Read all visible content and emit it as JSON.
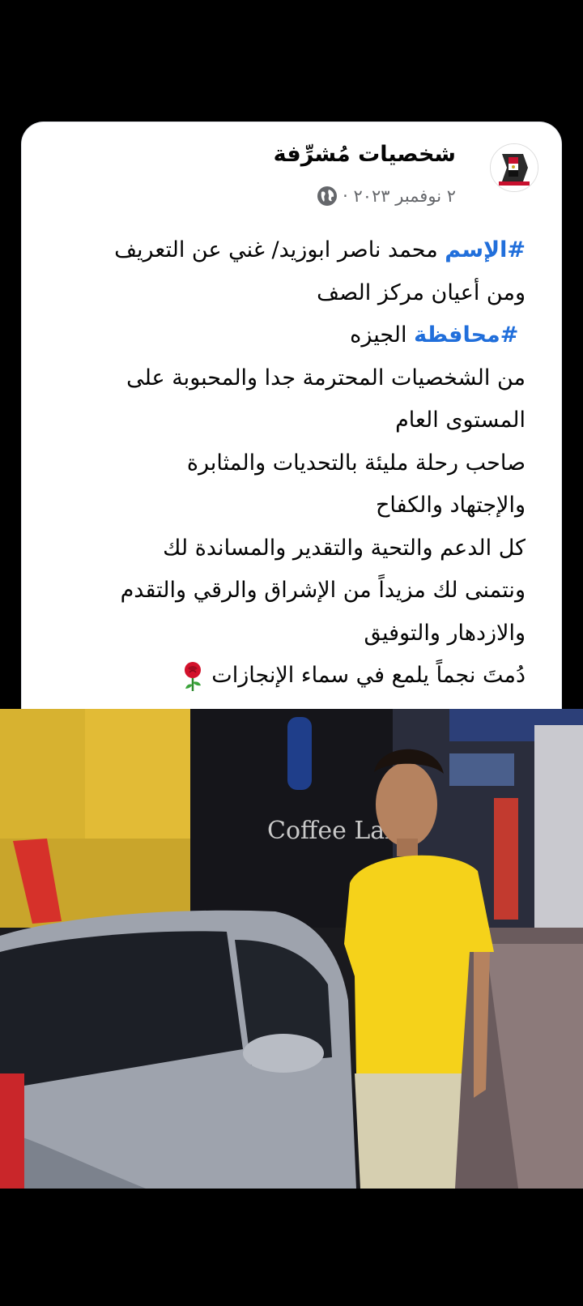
{
  "post": {
    "page_name": "شخصيات مُشرِّفة",
    "date": "٢ نوفمبر ٢٠٢٣ ·",
    "lines": [
      {
        "hashtag": "#الإسم",
        "text": " محمد ناصر ابوزيد/ غني عن التعريف"
      },
      {
        "hashtag": "",
        "text": "ومن أعيان مركز الصف"
      },
      {
        "hashtag": "#محافظة",
        "text": " الجيزه"
      },
      {
        "hashtag": "",
        "text": "من الشخصيات المحترمة جدا والمحبوبة على"
      },
      {
        "hashtag": "",
        "text": "المستوى العام"
      },
      {
        "hashtag": "",
        "text": "صاحب رحلة مليئة بالتحديات والمثابرة"
      },
      {
        "hashtag": "",
        "text": "والإجتهاد والكفاح"
      },
      {
        "hashtag": "",
        "text": "كل الدعم والتحية والتقدير والمساندة لك"
      },
      {
        "hashtag": "",
        "text": "ونتمنى لك مزيداً من الإشراق والرقي والتقدم"
      },
      {
        "hashtag": "",
        "text": "والازدهار والتوفيق"
      },
      {
        "hashtag": "",
        "text": "دُمتَ نجماً يلمع في سماء الإنجازات"
      }
    ],
    "photo_sign_text": "Coffee Lab",
    "colors": {
      "hashtag": "#216fdb",
      "verified": "#1877f2",
      "shirt": "#f5d21a"
    }
  }
}
